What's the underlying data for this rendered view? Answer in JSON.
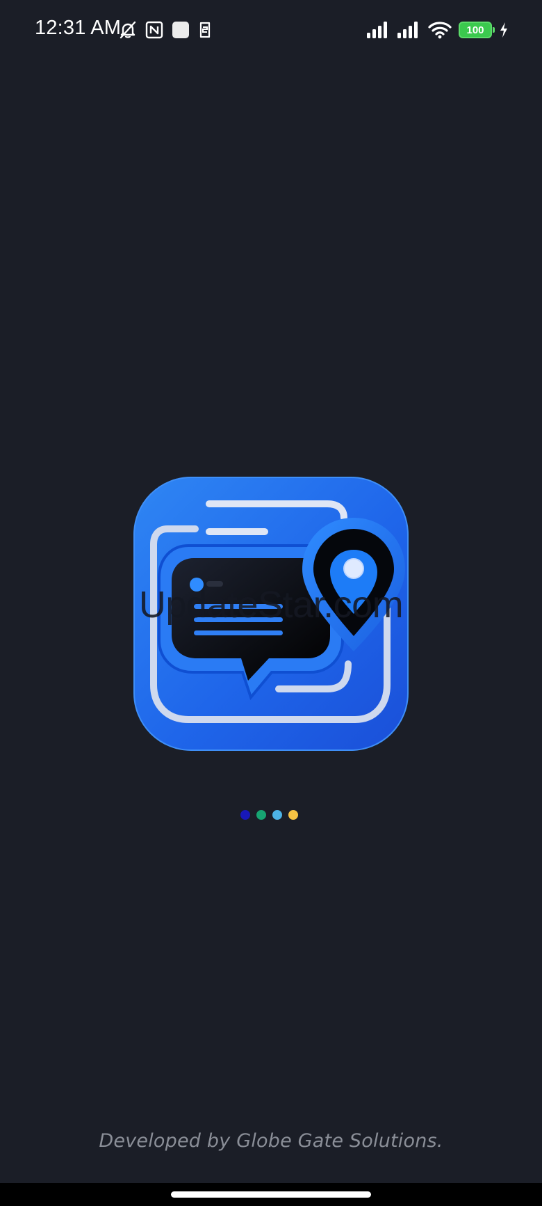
{
  "status_bar": {
    "time": "12:31 AM",
    "left_icons": [
      "muted-bell-icon",
      "nfc-icon",
      "app-square-icon",
      "sim-icon"
    ],
    "right_icons": [
      "signal-icon",
      "signal-icon",
      "wifi-icon",
      "battery-icon",
      "charging-icon"
    ],
    "battery_level": "100"
  },
  "splash": {
    "logo_icon": "chat-location-app-icon",
    "watermark_text": "UpdateStar.com",
    "loading_dots": [
      {
        "color": "#1818b8"
      },
      {
        "color": "#17a572"
      },
      {
        "color": "#4db3e6"
      },
      {
        "color": "#f6c344"
      }
    ],
    "footer_credit": "Developed by Globe Gate Solutions."
  },
  "colors": {
    "background": "#1b1e27",
    "logo_blue": "#1f6ff0",
    "battery_green": "#3bc94e"
  }
}
